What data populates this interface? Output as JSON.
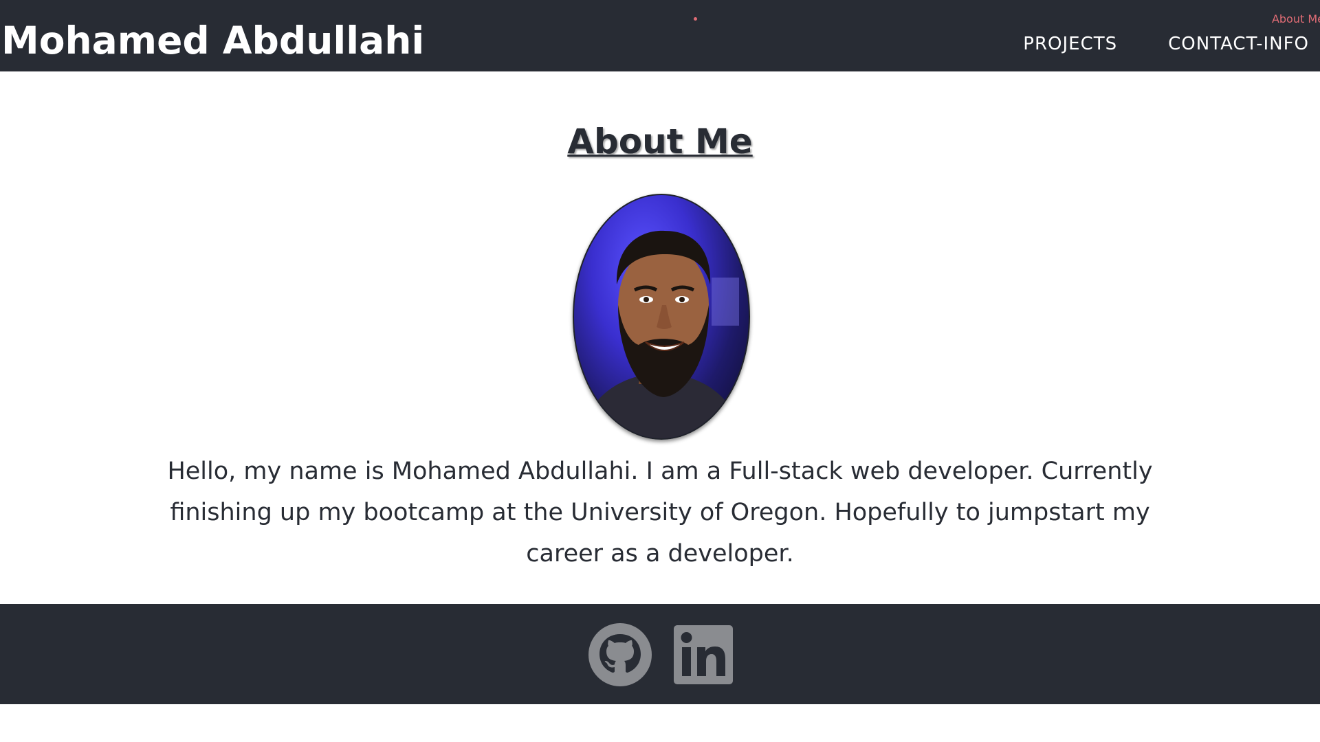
{
  "header": {
    "site_title": "Mohamed Abdullahi",
    "about_link_mini": "About Me",
    "nav": [
      {
        "label": "PROJECTS"
      },
      {
        "label": "CONTACT-INFO"
      }
    ]
  },
  "main": {
    "heading": "About Me",
    "bio": "Hello, my name is Mohamed Abdullahi. I am a Full-stack web developer. Currently finishing up my bootcamp at the University of Oregon. Hopefully to jumpstart my career as a developer."
  },
  "footer": {
    "icons": [
      "github-icon",
      "linkedin-icon"
    ]
  },
  "colors": {
    "bar_bg": "#282c34",
    "accent": "#e06c75",
    "icon_gray": "#8a8c90"
  }
}
